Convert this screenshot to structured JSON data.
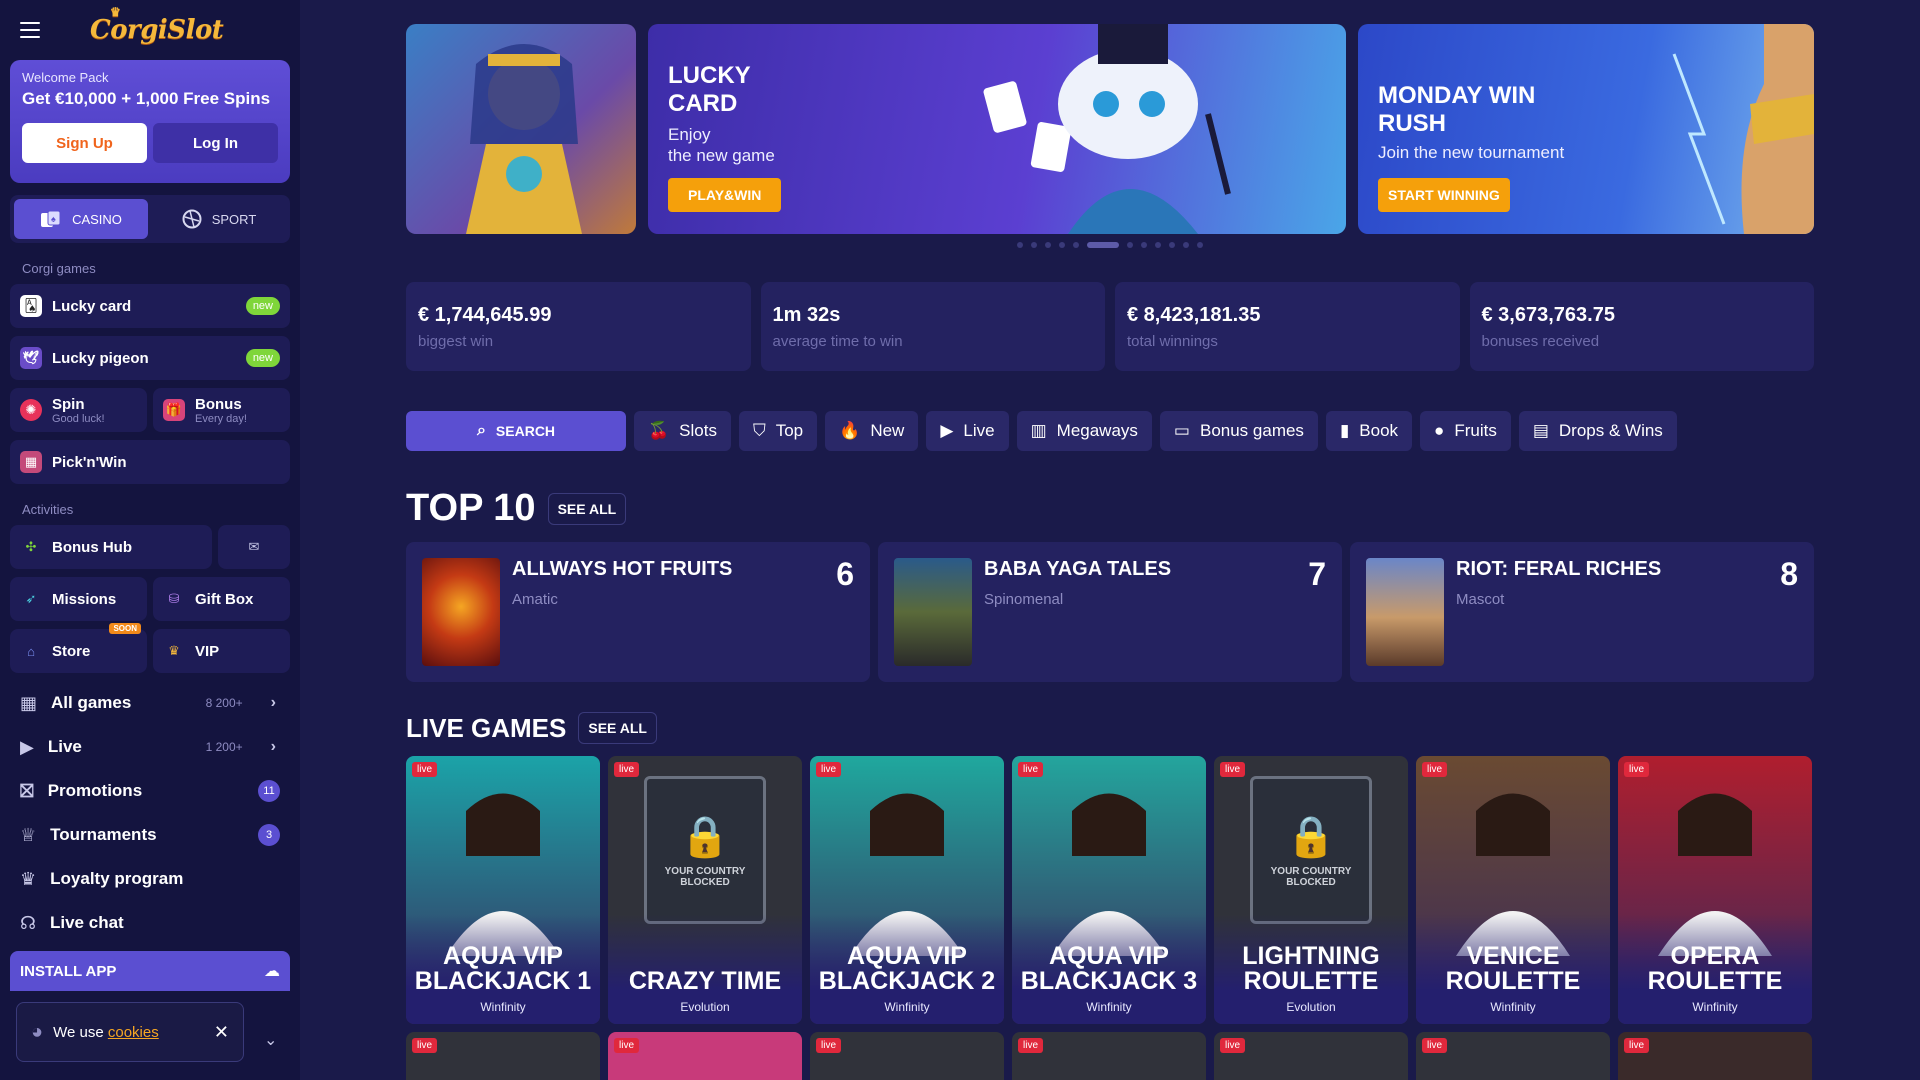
{
  "brand": {
    "logo": "CorgiSlot",
    "accent": "#5b4fd1",
    "orange": "#f5a00b"
  },
  "welcome": {
    "title": "Welcome Pack",
    "offer": "Get €10,000 + 1,000 Free Spins",
    "signup": "Sign Up",
    "login": "Log In"
  },
  "modes": [
    {
      "label": "CASINO",
      "icon": "casino-icon"
    },
    {
      "label": "SPORT",
      "icon": "sport-icon"
    }
  ],
  "corgi_section": "Corgi games",
  "corgi_games": [
    {
      "label": "Lucky card",
      "badge": "new"
    },
    {
      "label": "Lucky pigeon",
      "badge": "new"
    }
  ],
  "spin": {
    "label": "Spin",
    "sub": "Good luck!"
  },
  "bonus": {
    "label": "Bonus",
    "sub": "Every day!"
  },
  "picknwin": "Pick'n'Win",
  "activities_section": "Activities",
  "activities": {
    "bonus_hub": "Bonus Hub",
    "missions": "Missions",
    "gift_box": "Gift Box",
    "store": "Store",
    "store_badge": "SOON",
    "vip": "VIP"
  },
  "nav": [
    {
      "label": "All games",
      "count": "8 200+"
    },
    {
      "label": "Live",
      "count": "1 200+"
    },
    {
      "label": "Promotions",
      "pill": "11"
    },
    {
      "label": "Tournaments",
      "pill": "3"
    },
    {
      "label": "Loyalty program"
    },
    {
      "label": "Live chat"
    }
  ],
  "install": "INSTALL APP",
  "cookie": {
    "text": "We use",
    "link": "cookies"
  },
  "banners": [
    {
      "title": "LUCKY\nCARD",
      "sub": "Enjoy\nthe new game",
      "button": "PLAY&WIN"
    },
    {
      "title": "MONDAY WIN\nRUSH",
      "sub": "Join the new tournament",
      "button": "START WINNING"
    }
  ],
  "stats": [
    {
      "value": "€ 1,744,645.99",
      "label": "biggest win"
    },
    {
      "value": "1m 32s",
      "label": "average time to win"
    },
    {
      "value": "€ 8,423,181.35",
      "label": "total winnings"
    },
    {
      "value": "€ 3,673,763.75",
      "label": "bonuses received"
    }
  ],
  "filters": {
    "search": "SEARCH",
    "items": [
      "Slots",
      "Top",
      "New",
      "Live",
      "Megaways",
      "Bonus games",
      "Book",
      "Fruits",
      "Drops & Wins"
    ]
  },
  "top10": {
    "title": "TOP 10",
    "see_all": "SEE ALL",
    "cards": [
      {
        "name": "ALLWAYS HOT FRUITS",
        "provider": "Amatic",
        "rank": "6"
      },
      {
        "name": "BABA YAGA TALES",
        "provider": "Spinomenal",
        "rank": "7"
      },
      {
        "name": "RIOT: FERAL RICHES",
        "provider": "Mascot",
        "rank": "8"
      }
    ]
  },
  "live_games": {
    "title": "LIVE GAMES",
    "see_all": "SEE ALL",
    "tag": "live",
    "blocked_text": "YOUR COUNTRY\nBLOCKED",
    "cards": [
      {
        "name": "AQUA VIP BLACKJACK 1",
        "provider": "Winfinity",
        "blocked": false
      },
      {
        "name": "CRAZY TIME",
        "provider": "Evolution",
        "blocked": true
      },
      {
        "name": "AQUA VIP BLACKJACK 2",
        "provider": "Winfinity",
        "blocked": false
      },
      {
        "name": "AQUA VIP BLACKJACK 3",
        "provider": "Winfinity",
        "blocked": false
      },
      {
        "name": "LIGHTNING ROULETTE",
        "provider": "Evolution",
        "blocked": true
      },
      {
        "name": "VENICE ROULETTE",
        "provider": "Winfinity",
        "blocked": false
      },
      {
        "name": "OPERA ROULETTE",
        "provider": "Winfinity",
        "blocked": false
      }
    ]
  }
}
